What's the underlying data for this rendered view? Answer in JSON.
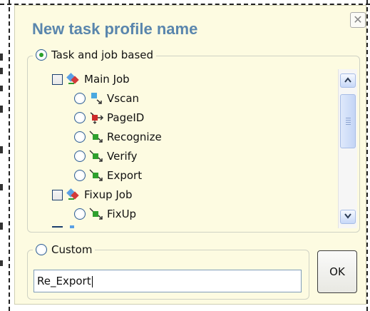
{
  "dialog": {
    "title": "New task profile name",
    "close_glyph": "✕"
  },
  "task_group": {
    "label": "Task and job based",
    "selected": true,
    "items": [
      {
        "type": "job",
        "label": "Main Job",
        "icon": "job-icon",
        "checked": false
      },
      {
        "type": "task",
        "label": "Vscan",
        "icon": "vscan-task-icon",
        "selected": false
      },
      {
        "type": "task",
        "label": "PageID",
        "icon": "pageid-task-icon",
        "selected": false
      },
      {
        "type": "task",
        "label": "Recognize",
        "icon": "recognize-task-icon",
        "selected": false
      },
      {
        "type": "task",
        "label": "Verify",
        "icon": "verify-task-icon",
        "selected": false
      },
      {
        "type": "task",
        "label": "Export",
        "icon": "export-task-icon",
        "selected": false
      },
      {
        "type": "job",
        "label": "Fixup Job",
        "icon": "job-icon",
        "checked": false
      },
      {
        "type": "task",
        "label": "FixUp",
        "icon": "fixup-task-icon",
        "selected": false
      }
    ]
  },
  "custom_group": {
    "label": "Custom",
    "selected": false
  },
  "name_input": {
    "value": "Re_Export"
  },
  "ok_button": {
    "label": "OK"
  },
  "colors": {
    "title": "#5a86ad",
    "panel_bg": "#fdfbe1",
    "radio_dot": "#2aa02a"
  }
}
